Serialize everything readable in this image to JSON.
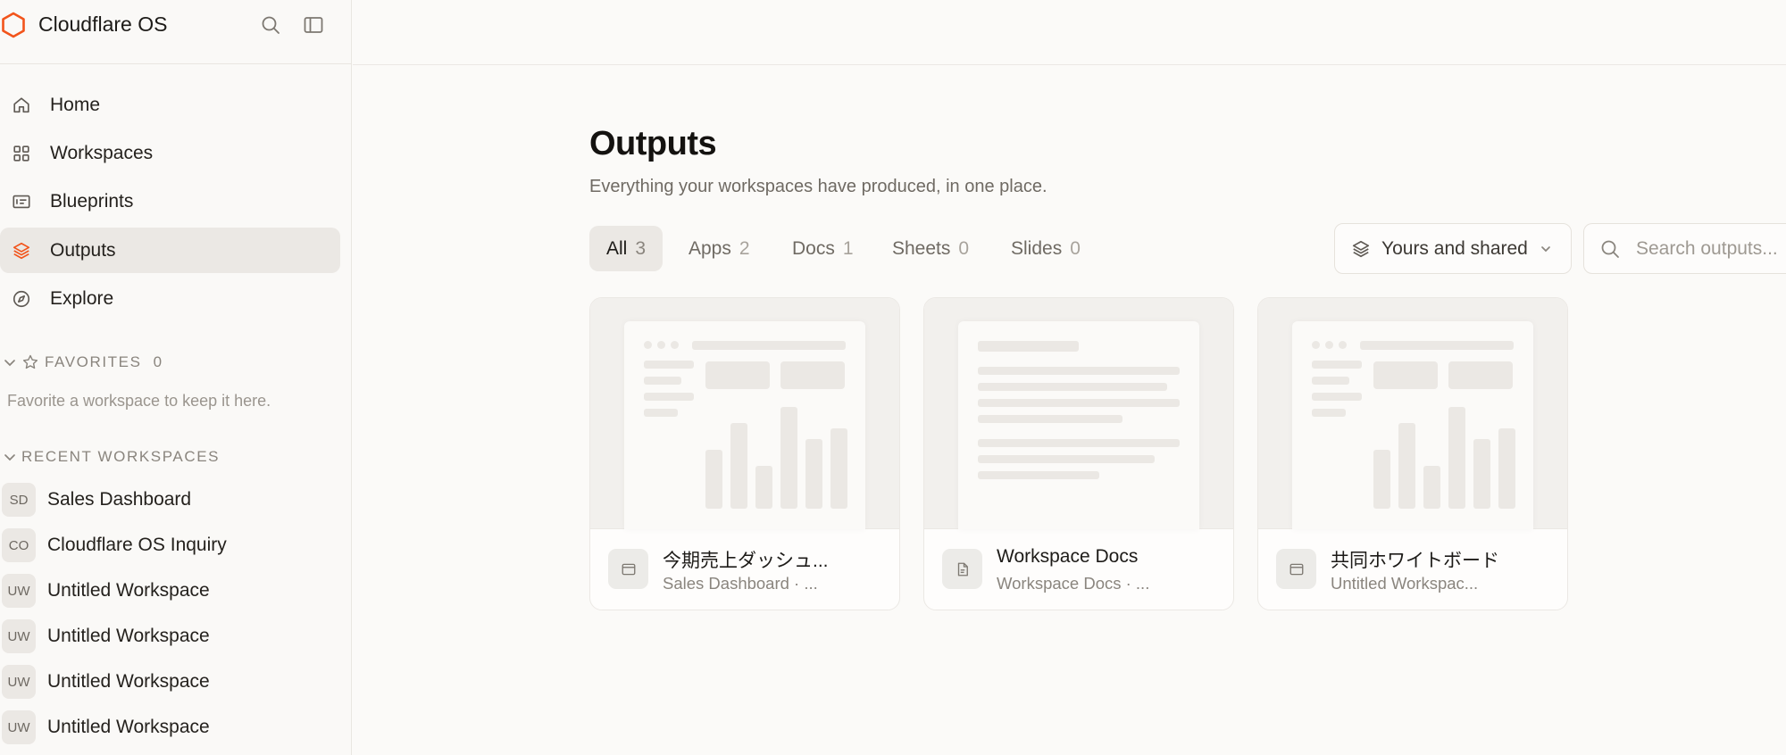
{
  "app": {
    "brand_name": "Cloudflare OS",
    "accent_color": "#f2541b"
  },
  "sidebar": {
    "header_icons": [
      "search-icon",
      "sidebar-toggle-icon"
    ],
    "nav": [
      {
        "label": "Home",
        "icon": "home-icon",
        "active": false
      },
      {
        "label": "Workspaces",
        "icon": "grid-icon",
        "active": false
      },
      {
        "label": "Blueprints",
        "icon": "blueprint-icon",
        "active": false
      },
      {
        "label": "Outputs",
        "icon": "layers-icon",
        "active": true
      },
      {
        "label": "Explore",
        "icon": "compass-icon",
        "active": false
      }
    ],
    "favorites": {
      "label": "FAVORITES",
      "count": "0",
      "empty_text": "Favorite a workspace to keep it here."
    },
    "recent": {
      "label": "RECENT WORKSPACES",
      "items": [
        {
          "initials": "SD",
          "name": "Sales Dashboard"
        },
        {
          "initials": "CO",
          "name": "Cloudflare OS Inquiry"
        },
        {
          "initials": "UW",
          "name": "Untitled Workspace"
        },
        {
          "initials": "UW",
          "name": "Untitled Workspace"
        },
        {
          "initials": "UW",
          "name": "Untitled Workspace"
        },
        {
          "initials": "UW",
          "name": "Untitled Workspace"
        }
      ]
    }
  },
  "main": {
    "title": "Outputs",
    "subtitle": "Everything your workspaces have produced, in one place.",
    "tabs": [
      {
        "label": "All",
        "count": "3",
        "active": true
      },
      {
        "label": "Apps",
        "count": "2",
        "active": false
      },
      {
        "label": "Docs",
        "count": "1",
        "active": false
      },
      {
        "label": "Sheets",
        "count": "0",
        "active": false
      },
      {
        "label": "Slides",
        "count": "0",
        "active": false
      }
    ],
    "filter": {
      "label": "Yours and shared"
    },
    "search": {
      "placeholder": "Search outputs..."
    },
    "cards": [
      {
        "title": "今期売上ダッシュ...",
        "subtitle": "Sales Dashboard · ...",
        "kind": "app",
        "icon": "app-window-icon"
      },
      {
        "title": "Workspace Docs",
        "subtitle": "Workspace Docs · ...",
        "kind": "doc",
        "icon": "document-icon"
      },
      {
        "title": "共同ホワイトボード",
        "subtitle": "Untitled Workspac...",
        "kind": "app",
        "icon": "app-window-icon"
      }
    ]
  }
}
